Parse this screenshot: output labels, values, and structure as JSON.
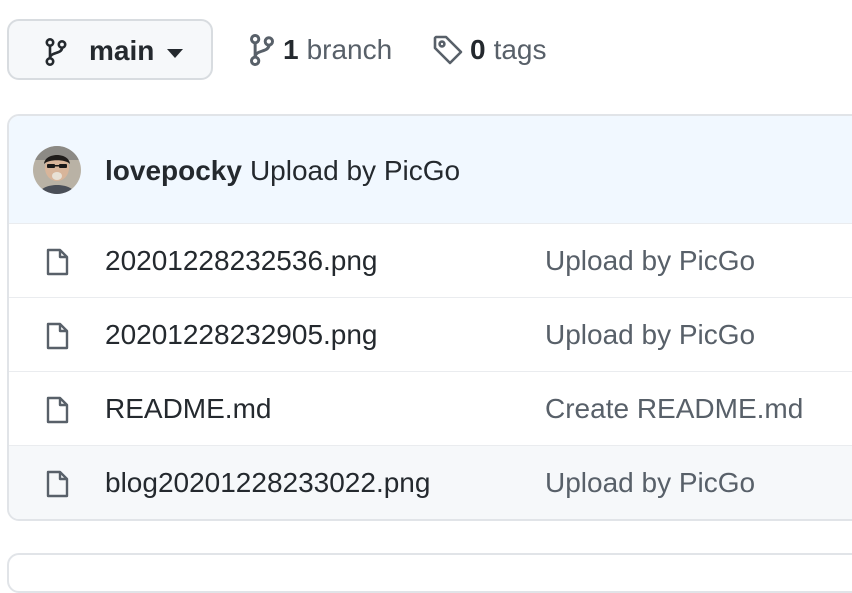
{
  "branch_selector": {
    "label": "main",
    "icon": "git-branch-icon"
  },
  "branches": {
    "count": "1",
    "label": "branch",
    "icon": "git-branch-icon"
  },
  "tags": {
    "count": "0",
    "label": "tags",
    "icon": "tag-icon"
  },
  "latest_commit": {
    "author": "lovepocky",
    "message": "Upload by PicGo"
  },
  "files": [
    {
      "name": "20201228232536.png",
      "message": "Upload by PicGo",
      "icon": "file-icon"
    },
    {
      "name": "20201228232905.png",
      "message": "Upload by PicGo",
      "icon": "file-icon"
    },
    {
      "name": "README.md",
      "message": "Create README.md",
      "icon": "file-icon"
    },
    {
      "name": "blog20201228233022.png",
      "message": "Upload by PicGo",
      "icon": "file-icon"
    }
  ],
  "colors": {
    "header_bg": "#f1f8ff",
    "text": "#24292e",
    "muted": "#586069",
    "border": "#e1e4e8"
  }
}
